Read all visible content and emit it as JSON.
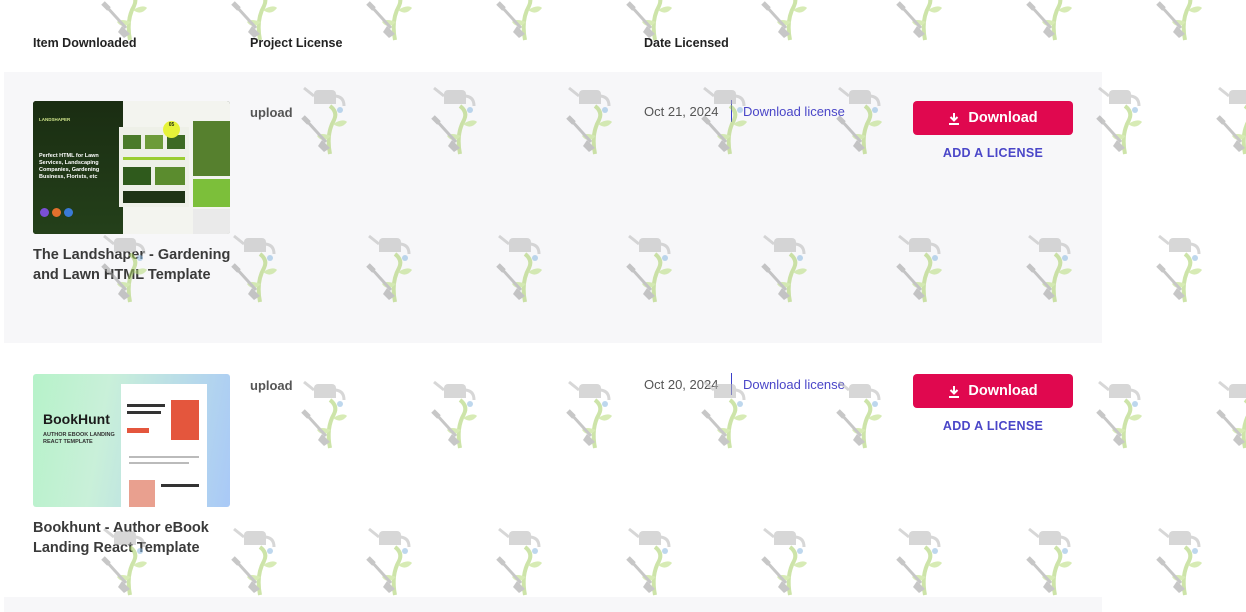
{
  "table": {
    "headers": {
      "item": "Item Downloaded",
      "project": "Project License",
      "date": "Date Licensed"
    },
    "rows": [
      {
        "title": "The Landshaper - Gardening and Lawn HTML Template",
        "thumb_text": "Perfect HTML for Lawn Services, Landscaping Companies, Gardening Business, Florists, etc",
        "thumb_logo": "LANDSHAPER",
        "thumb_badge": "05",
        "project_license": "upload",
        "date": "Oct 21, 2024",
        "download_license": "Download license",
        "download_button": "Download",
        "add_license": "ADD A LICENSE"
      },
      {
        "title": "Bookhunt - Author eBook Landing React Template",
        "thumb_name": "BookHunt",
        "thumb_sub": "AUTHOR EBOOK LANDING REACT TEMPLATE",
        "project_license": "upload",
        "date": "Oct 20, 2024",
        "download_license": "Download license",
        "download_button": "Download",
        "add_license": "ADD A LICENSE"
      }
    ]
  },
  "colors": {
    "accent_button": "#e0084f",
    "link": "#4a46c8",
    "row_bg": "#f7f7f9"
  },
  "icons": {
    "download": "download-arrow-icon",
    "watermark": "watering-can-shovel-icon"
  }
}
